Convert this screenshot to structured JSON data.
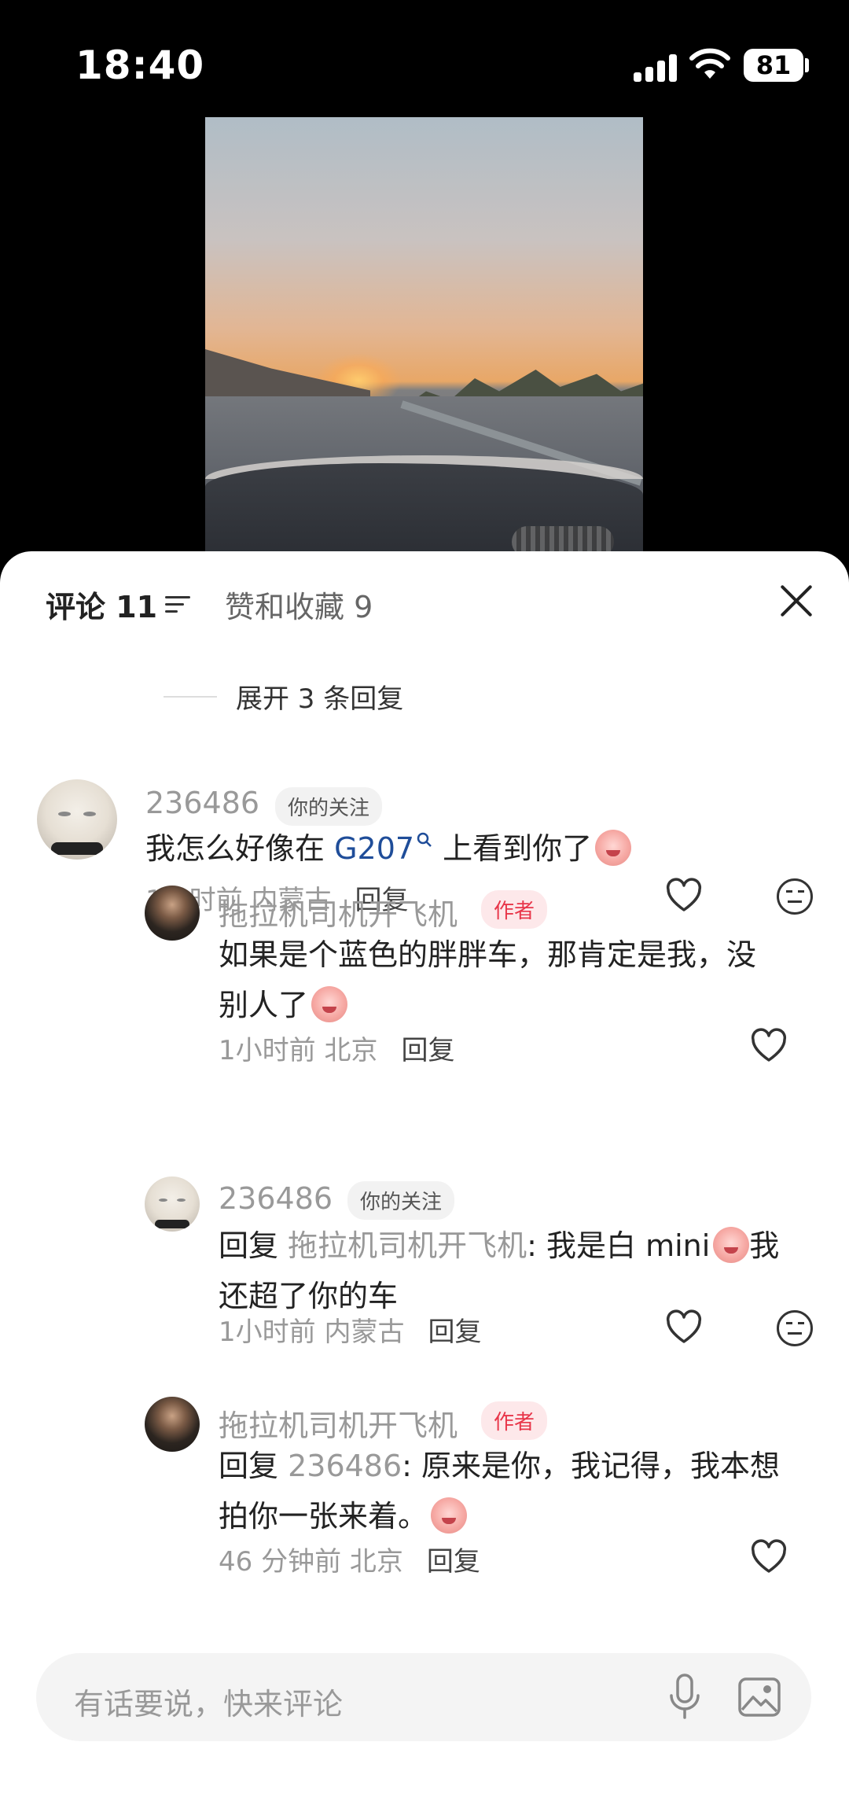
{
  "status_bar": {
    "time": "18:40",
    "battery": "81",
    "icons": [
      "signal-icon",
      "wifi-icon",
      "battery-icon"
    ]
  },
  "video": {
    "description_icon": "dashcam-sunset-highway"
  },
  "header": {
    "comments_tab": "评论 11",
    "likes_tab": "赞和收藏 9",
    "sort_icon": "sort-icon",
    "close_icon": "close-icon"
  },
  "expand_replies": "展开 3 条回复",
  "comments": [
    {
      "username": "236486",
      "badge": "你的关注",
      "text_before": "我怎么好像在 ",
      "link": "G207",
      "link_icon": "search-icon",
      "text_after": " 上看到你了",
      "time": "1小时前",
      "location": "内蒙古",
      "reply_label": "回复"
    },
    {
      "username": "拖拉机司机开飞机",
      "badge": "作者",
      "text_line1": "如果是个蓝色的胖胖车，那肯定是我，没",
      "text_line2": "别人了",
      "time": "1小时前",
      "location": "北京",
      "reply_label": "回复"
    },
    {
      "username": "236486",
      "badge": "你的关注",
      "reply_prefix": "回复 ",
      "reply_to": "拖拉机司机开飞机",
      "text_line1": ": 我是白 mini",
      "text_line1_end": "我",
      "text_line2": "还超了你的车",
      "time": "1小时前",
      "location": "内蒙古",
      "reply_label": "回复"
    },
    {
      "username": "拖拉机司机开飞机",
      "badge": "作者",
      "reply_prefix": "回复 ",
      "reply_to": "236486",
      "text_line1": ": 原来是你，我记得，我本想",
      "text_line2": "拍你一张来着。",
      "time": "46 分钟前",
      "location": "北京",
      "reply_label": "回复"
    }
  ],
  "input": {
    "placeholder": "有话要说，快来评论",
    "mic_icon": "microphone-icon",
    "image_icon": "image-icon"
  },
  "colors": {
    "accent_link": "#1f4d99",
    "author_badge": "#e8364a",
    "sheet_bg": "#ffffff",
    "page_bg": "#000000"
  }
}
